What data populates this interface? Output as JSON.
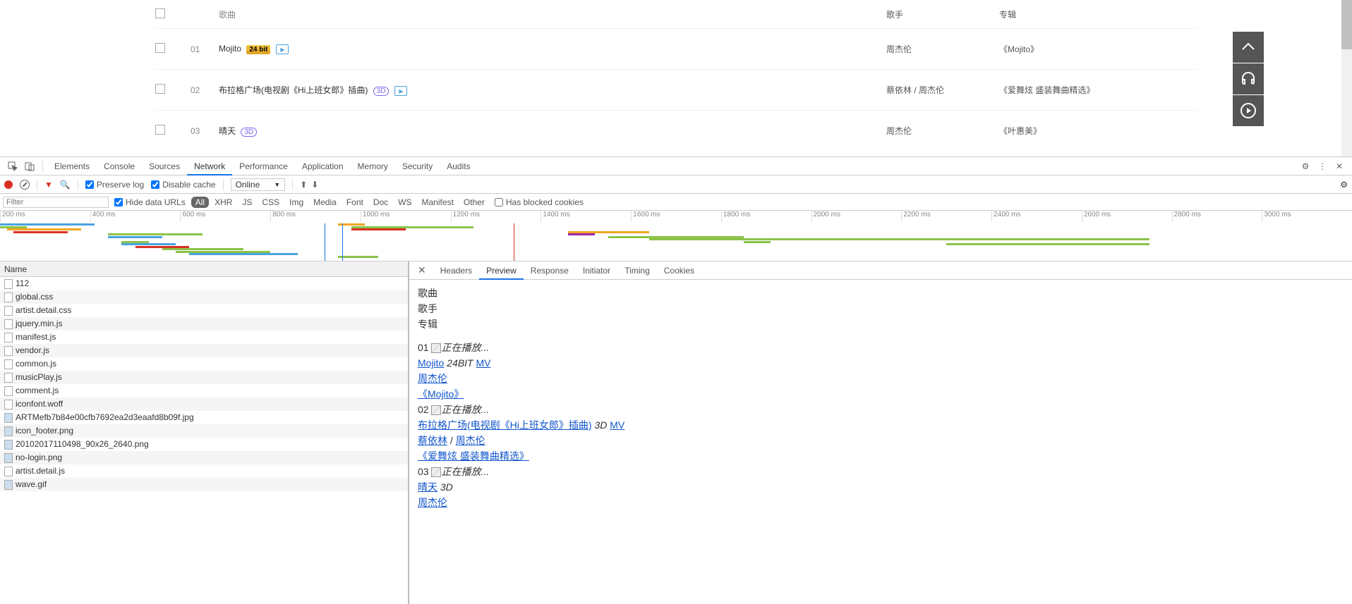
{
  "music": {
    "headers": {
      "title": "歌曲",
      "artist": "歌手",
      "album": "专辑"
    },
    "songs": [
      {
        "num": "01",
        "title": "Mojito",
        "badge": "24bit",
        "artist": "周杰伦",
        "album": "《Mojito》"
      },
      {
        "num": "02",
        "title": "布拉格广场(电视剧《Hi上班女郎》插曲)",
        "badge": "3d",
        "artist": "蔡依林 / 周杰伦",
        "album": "《爱舞炫 盛装舞曲精选》"
      },
      {
        "num": "03",
        "title": "晴天",
        "badge": "3d",
        "artist": "周杰伦",
        "album": "《叶惠美》"
      }
    ]
  },
  "devtools": {
    "main_tabs": [
      "Elements",
      "Console",
      "Sources",
      "Network",
      "Performance",
      "Application",
      "Memory",
      "Security",
      "Audits"
    ],
    "active_main_tab": "Network",
    "toolbar": {
      "preserve_log": "Preserve log",
      "disable_cache": "Disable cache",
      "throttle": "Online"
    },
    "filter": {
      "placeholder": "Filter",
      "hide_data_urls": "Hide data URLs",
      "types": [
        "All",
        "XHR",
        "JS",
        "CSS",
        "Img",
        "Media",
        "Font",
        "Doc",
        "WS",
        "Manifest",
        "Other"
      ],
      "active_type": "All",
      "blocked_cookies": "Has blocked cookies"
    },
    "timeline_ticks": [
      "200 ms",
      "400 ms",
      "600 ms",
      "800 ms",
      "1000 ms",
      "1200 ms",
      "1400 ms",
      "1600 ms",
      "1800 ms",
      "2000 ms",
      "2200 ms",
      "2400 ms",
      "2600 ms",
      "2800 ms",
      "3000 ms"
    ],
    "requests": {
      "name_header": "Name",
      "items": [
        {
          "name": "112",
          "type": "doc"
        },
        {
          "name": "global.css",
          "type": "css"
        },
        {
          "name": "artist.detail.css",
          "type": "css"
        },
        {
          "name": "jquery.min.js",
          "type": "js"
        },
        {
          "name": "manifest.js",
          "type": "js"
        },
        {
          "name": "vendor.js",
          "type": "js"
        },
        {
          "name": "common.js",
          "type": "js"
        },
        {
          "name": "musicPlay.js",
          "type": "js"
        },
        {
          "name": "comment.js",
          "type": "js"
        },
        {
          "name": "iconfont.woff",
          "type": "font"
        },
        {
          "name": "ARTMefb7b84e00cfb7692ea2d3eaafd8b09f.jpg",
          "type": "img"
        },
        {
          "name": "icon_footer.png",
          "type": "img"
        },
        {
          "name": "20102017110498_90x26_2640.png",
          "type": "img"
        },
        {
          "name": "no-login.png",
          "type": "img"
        },
        {
          "name": "artist.detail.js",
          "type": "js"
        },
        {
          "name": "wave.gif",
          "type": "img"
        }
      ]
    },
    "detail_tabs": [
      "Headers",
      "Preview",
      "Response",
      "Initiator",
      "Timing",
      "Cookies"
    ],
    "active_detail_tab": "Preview",
    "preview": {
      "header_labels": [
        "歌曲",
        "歌手",
        "专辑"
      ],
      "playing_alt": "正在播放...",
      "items": [
        {
          "num": "01",
          "title": "Mojito",
          "badge": "24BIT",
          "mv": "MV",
          "artists": [
            "周杰伦"
          ],
          "album": "《Mojito》"
        },
        {
          "num": "02",
          "title": "布拉格广场(电视剧《Hi上班女郎》插曲)",
          "badge": "3D",
          "mv": "MV",
          "artists": [
            "蔡依林",
            "周杰伦"
          ],
          "album": "《爱舞炫 盛装舞曲精选》"
        },
        {
          "num": "03",
          "title": "晴天",
          "badge": "3D",
          "mv": "",
          "artists": [
            "周杰伦"
          ],
          "album": ""
        }
      ]
    }
  }
}
